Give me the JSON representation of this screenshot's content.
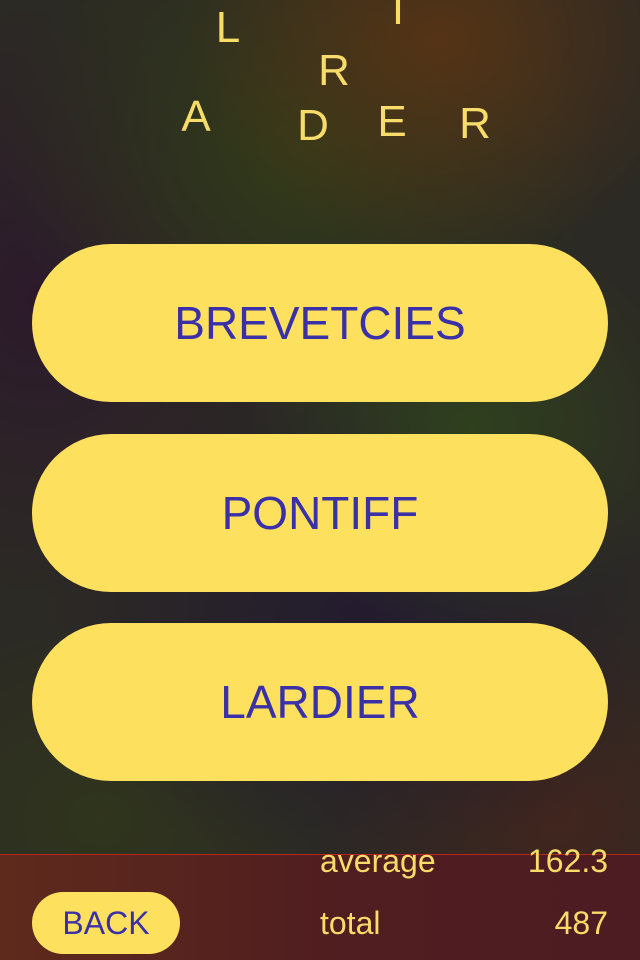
{
  "scramble": {
    "letters": [
      "L",
      "I",
      "R",
      "A",
      "D",
      "E",
      "R"
    ]
  },
  "answers": [
    "BREVETCIES",
    "PONTIFF",
    "LARDIER"
  ],
  "footer": {
    "back_label": "BACK",
    "average_label": "average",
    "average_value": "162.3",
    "total_label": "total",
    "total_value": "487"
  },
  "colors": {
    "button_bg": "#fde05e",
    "button_text": "#3a31a8",
    "letter_color": "#f7dc6a",
    "footer_line": "#b8261e"
  }
}
